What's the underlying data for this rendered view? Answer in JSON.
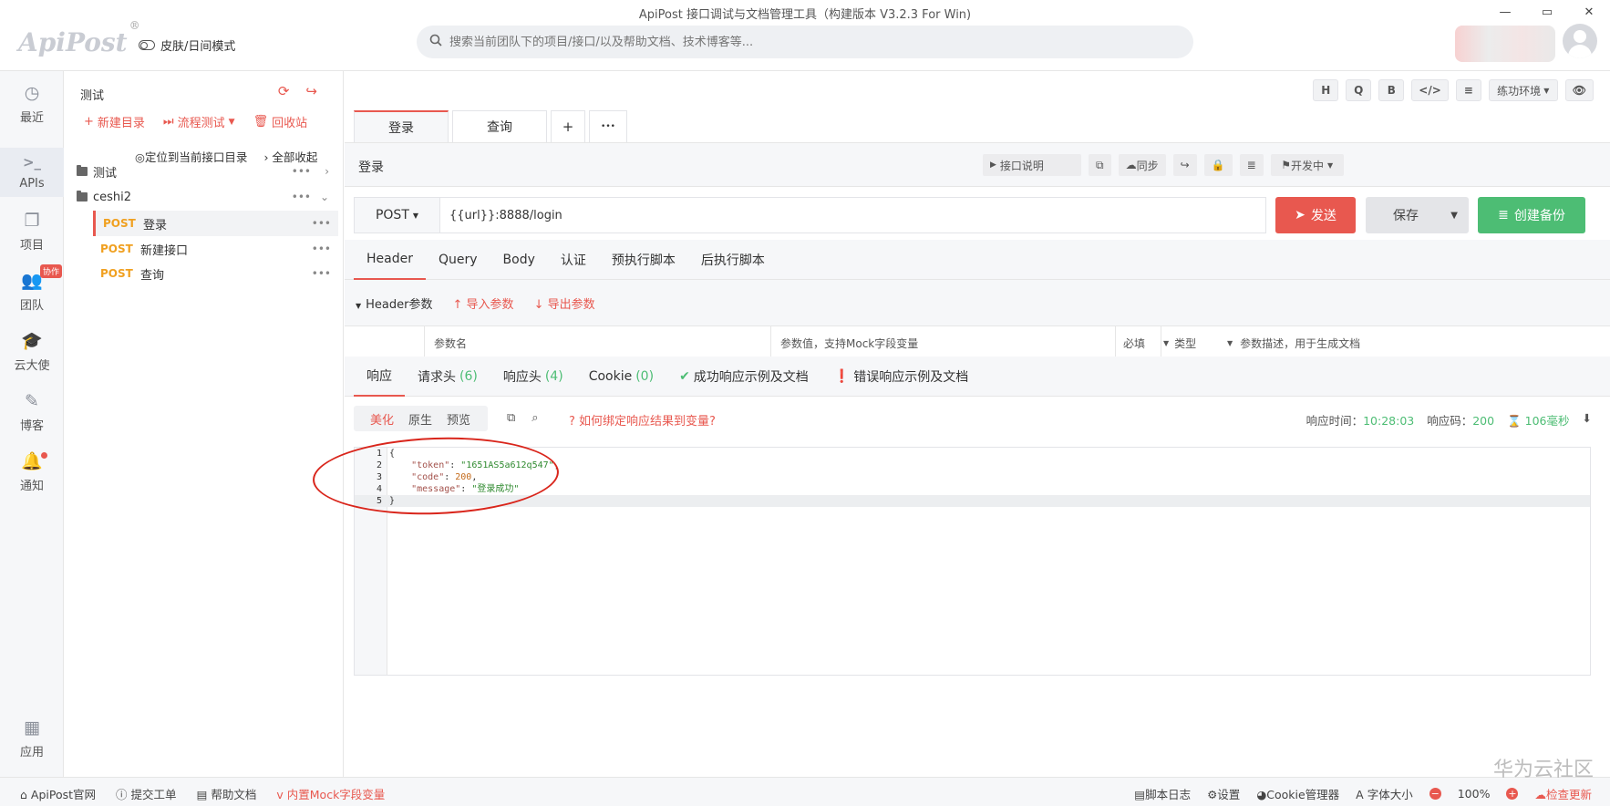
{
  "window": {
    "title": "ApiPost 接口调试与文档管理工具（构建版本 V3.2.3 For Win)",
    "logo": "ApiPost",
    "logo_mark": "®",
    "skin_label": "皮肤/日间模式",
    "search_placeholder": "搜索当前团队下的项目/接口/以及帮助文档、技术博客等...",
    "controls": [
      "—",
      "▭",
      "✕"
    ]
  },
  "rail": {
    "items": [
      {
        "label": "最近",
        "icon": "clock-icon"
      },
      {
        "label": "APIs",
        "icon": "terminal-icon"
      },
      {
        "label": "项目",
        "icon": "project-icon"
      },
      {
        "label": "团队",
        "icon": "team-icon",
        "badge": "协作"
      },
      {
        "label": "云大使",
        "icon": "graduation-cap-icon"
      },
      {
        "label": "博客",
        "icon": "edit-icon"
      },
      {
        "label": "通知",
        "icon": "bell-icon"
      },
      {
        "label": "应用",
        "icon": "apps-grid-icon"
      }
    ]
  },
  "tree": {
    "title": "测试",
    "actions": {
      "new_dir": "新建目录",
      "flow_test": "流程测试",
      "recycle": "回收站"
    },
    "locate": "定位到当前接口目录",
    "collapse_all": "全部收起",
    "folders": [
      {
        "name": "测试",
        "expanded": false
      },
      {
        "name": "ceshi2",
        "expanded": true
      }
    ],
    "apis": [
      {
        "method": "POST",
        "name": "登录",
        "selected": true
      },
      {
        "method": "POST",
        "name": "新建接口",
        "selected": false
      },
      {
        "method": "POST",
        "name": "查询",
        "selected": false
      }
    ]
  },
  "toolbar": {
    "buttons": [
      "H",
      "Q",
      "B",
      "</>",
      "≡"
    ],
    "env": "练功环境",
    "eye": "👁"
  },
  "tabs": [
    {
      "label": "登录",
      "active": true
    },
    {
      "label": "查询",
      "active": false
    }
  ],
  "tab_add": "+",
  "tab_more": "•••",
  "request": {
    "name": "登录",
    "doc_label": "接口说明",
    "sync_label": "同步",
    "status_label": "开发中",
    "method": "POST",
    "url": "{{url}}:8888/login",
    "send": "发送",
    "save": "保存",
    "backup": "创建备份"
  },
  "req_tabs": [
    "Header",
    "Query",
    "Body",
    "认证",
    "预执行脚本",
    "后执行脚本"
  ],
  "header_params": {
    "title": "Header参数",
    "import": "导入参数",
    "export": "导出参数",
    "col_name": "参数名",
    "col_value": "参数值，支持Mock字段变量",
    "col_required": "必填",
    "col_type": "类型",
    "col_desc": "参数描述，用于生成文档"
  },
  "resp_tabs": {
    "response": "响应",
    "req_headers": "请求头",
    "req_headers_count": "(6)",
    "resp_headers": "响应头",
    "resp_headers_count": "(4)",
    "cookie": "Cookie",
    "cookie_count": "(0)",
    "success_doc": "成功响应示例及文档",
    "error_doc": "错误响应示例及文档"
  },
  "response": {
    "view_modes": [
      "美化",
      "原生",
      "预览"
    ],
    "bind_tip": "如何绑定响应结果到变量?",
    "time_label": "响应时间：",
    "time": "10:28:03",
    "code_label": "响应码：",
    "code": "200",
    "duration": "106毫秒",
    "lines": [
      {
        "n": "1",
        "text": "{"
      },
      {
        "n": "2",
        "key": "\"token\"",
        "value": "\"1651AS5a612q547\"",
        "type": "str",
        "tail": ","
      },
      {
        "n": "3",
        "key": "\"code\"",
        "value": "200",
        "type": "num",
        "tail": ","
      },
      {
        "n": "4",
        "key": "\"message\"",
        "value": "\"登录成功\"",
        "type": "str",
        "tail": ""
      },
      {
        "n": "5",
        "text": "}"
      }
    ]
  },
  "statusbar": {
    "left": [
      "ApiPost官网",
      "提交工单",
      "帮助文档",
      "内置Mock字段变量"
    ],
    "right": {
      "log": "脚本日志",
      "settings": "设置",
      "cookie": "Cookie管理器",
      "font": "字体大小",
      "zoom": "100%",
      "update": "检查更新"
    }
  },
  "watermark": "华为云社区",
  "colors": {
    "accent": "#e8584f",
    "green": "#4dbd74",
    "method": "#f0a020"
  }
}
